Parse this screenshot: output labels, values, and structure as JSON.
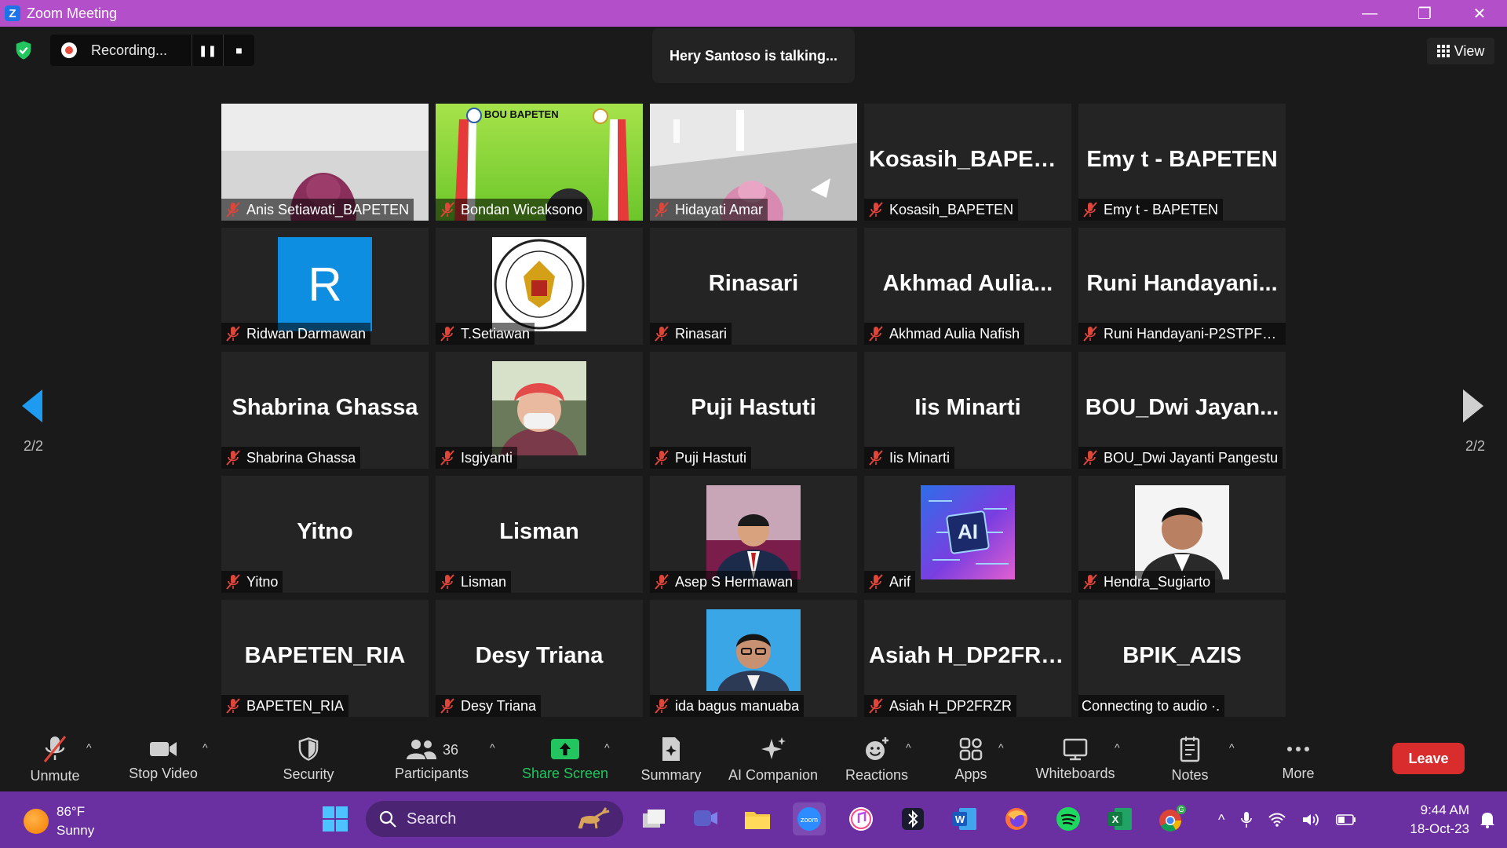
{
  "window": {
    "title": "Zoom Meeting"
  },
  "recording": {
    "label": "Recording..."
  },
  "active_speaker": "Hery Santoso is talking...",
  "view_label": "View",
  "pagination": {
    "left": "2/2",
    "right": "2/2"
  },
  "tiles": [
    {
      "big": "",
      "name": "Anis Setiawati_BAPETEN",
      "media": "photo-hijab"
    },
    {
      "big": "",
      "name": "Bondan Wicaksono",
      "media": "photo-green",
      "logo_text": "BOU BAPETEN"
    },
    {
      "big": "",
      "name": "Hidayati Amar",
      "media": "photo-ceiling"
    },
    {
      "big": "Kosasih_BAPETEN",
      "name": "Kosasih_BAPETEN",
      "media": "none"
    },
    {
      "big": "Emy t - BAPETEN",
      "name": "Emy t - BAPETEN",
      "media": "none"
    },
    {
      "big": "",
      "name": "Ridwan Darmawan",
      "media": "avatar-letter",
      "avatar_letter": "R"
    },
    {
      "big": "",
      "name": "T.Setiawan",
      "media": "emblem"
    },
    {
      "big": "Rinasari",
      "name": "Rinasari",
      "media": "none"
    },
    {
      "big": "Akhmad  Aulia...",
      "name": "Akhmad Aulia Nafish",
      "media": "none"
    },
    {
      "big": "Runi  Handayani...",
      "name": "Runi Handayani-P2STPFR...",
      "media": "none"
    },
    {
      "big": "Shabrina Ghassa",
      "name": "Shabrina Ghassa",
      "media": "none"
    },
    {
      "big": "",
      "name": "Isgiyanti",
      "media": "photo-mask"
    },
    {
      "big": "Puji Hastuti",
      "name": "Puji Hastuti",
      "media": "none"
    },
    {
      "big": "Iis Minarti",
      "name": "Iis Minarti",
      "media": "none"
    },
    {
      "big": "BOU_Dwi  Jayan...",
      "name": "BOU_Dwi Jayanti Pangestu",
      "media": "none"
    },
    {
      "big": "Yitno",
      "name": "Yitno",
      "media": "none"
    },
    {
      "big": "Lisman",
      "name": "Lisman",
      "media": "none"
    },
    {
      "big": "",
      "name": "Asep S Hermawan",
      "media": "photo-suit"
    },
    {
      "big": "",
      "name": "Arif",
      "media": "photo-ai",
      "chip_text": "AI"
    },
    {
      "big": "",
      "name": "Hendra_Sugiarto",
      "media": "photo-portrait"
    },
    {
      "big": "BAPETEN_RIA",
      "name": "BAPETEN_RIA",
      "media": "none"
    },
    {
      "big": "Desy Triana",
      "name": "Desy Triana",
      "media": "none"
    },
    {
      "big": "",
      "name": "ida bagus manuaba",
      "media": "photo-blue"
    },
    {
      "big": "Asiah H_DP2FRZR",
      "name": "Asiah H_DP2FRZR",
      "media": "none"
    },
    {
      "big": "BPIK_AZIS",
      "name": "Connecting to audio ·.",
      "media": "none",
      "no_mic": true
    }
  ],
  "toolbar": {
    "unmute": "Unmute",
    "stop_video": "Stop Video",
    "security": "Security",
    "participants": "Participants",
    "participants_count": "36",
    "share_screen": "Share Screen",
    "summary": "Summary",
    "ai_companion": "AI Companion",
    "reactions": "Reactions",
    "apps": "Apps",
    "whiteboards": "Whiteboards",
    "notes": "Notes",
    "more": "More",
    "leave": "Leave"
  },
  "taskbar": {
    "weather_temp": "86°F",
    "weather_desc": "Sunny",
    "search_placeholder": "Search",
    "time": "9:44 AM",
    "date": "18-Oct-23"
  },
  "colors": {
    "titlebar": "#b24fc9",
    "taskbar": "#6a2fa0",
    "share_green": "#22c55e",
    "leave_red": "#d92d2d",
    "muted_red": "#e0453a"
  }
}
